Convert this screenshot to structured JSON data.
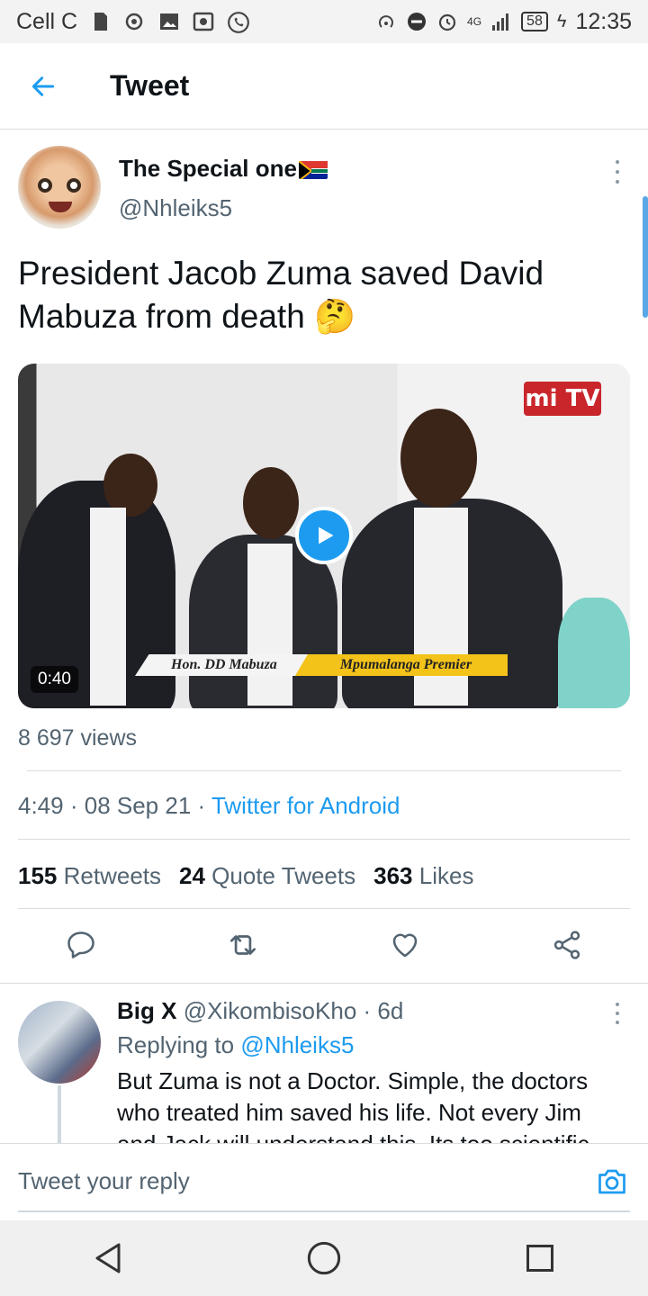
{
  "status_bar": {
    "carrier": "Cell C",
    "network": "4G",
    "battery": "58",
    "time": "12:35"
  },
  "header": {
    "title": "Tweet"
  },
  "tweet": {
    "display_name": "The Special one",
    "handle": "@Nhleiks5",
    "text": "President Jacob Zuma saved David Mabuza from death 🤔",
    "video": {
      "duration": "0:40",
      "overlay_logo": "mi TV",
      "lower_third_name": "Hon. DD Mabuza",
      "lower_third_title": "Mpumalanga Premier"
    },
    "views": "8 697 views",
    "time": "4:49",
    "date": "08 Sep 21",
    "source": "Twitter for Android",
    "stats": {
      "retweets_count": "155",
      "retweets_label": "Retweets",
      "quotes_count": "24",
      "quotes_label": "Quote Tweets",
      "likes_count": "363",
      "likes_label": "Likes"
    }
  },
  "reply": {
    "display_name": "Big X",
    "handle": "@XikombisoKho",
    "age": "6d",
    "replying_prefix": "Replying to",
    "replying_to": "@Nhleiks5",
    "text": "But Zuma is not a Doctor. Simple, the doctors who treated him saved his life. Not every Jim and Jack will understand this. Its too scientific"
  },
  "compose": {
    "placeholder": "Tweet your reply"
  },
  "colors": {
    "accent": "#1d9bf0",
    "secondary_text": "#536471",
    "primary_text": "#0f1419"
  }
}
